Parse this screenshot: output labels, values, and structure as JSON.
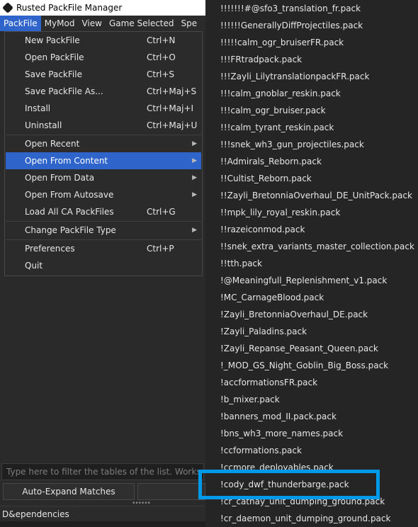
{
  "window": {
    "title": "Rusted PackFile Manager"
  },
  "menubar": [
    "PackFile",
    "MyMod",
    "View",
    "Game Selected",
    "Spe"
  ],
  "packfile_menu": {
    "items": [
      {
        "label": "New PackFile",
        "shortcut": "Ctrl+N"
      },
      {
        "label": "Open PackFile",
        "shortcut": "Ctrl+O"
      },
      {
        "label": "Save PackFile",
        "shortcut": "Ctrl+S"
      },
      {
        "label": "Save PackFile As...",
        "shortcut": "Ctrl+Maj+S"
      },
      {
        "label": "Install",
        "shortcut": "Ctrl+Maj+I"
      },
      {
        "label": "Uninstall",
        "shortcut": "Ctrl+Maj+U"
      },
      {
        "label": "Open Recent",
        "shortcut": ""
      },
      {
        "label": "Open From Content",
        "shortcut": ""
      },
      {
        "label": "Open From Data",
        "shortcut": ""
      },
      {
        "label": "Open From Autosave",
        "shortcut": ""
      },
      {
        "label": "Load All CA PackFiles",
        "shortcut": "Ctrl+G"
      },
      {
        "label": "Change PackFile Type",
        "shortcut": ""
      },
      {
        "label": "Preferences",
        "shortcut": "Ctrl+P"
      },
      {
        "label": "Quit",
        "shortcut": ""
      }
    ]
  },
  "submenu_arrow": "chevron-right-icon",
  "content_list": {
    "items": [
      "!!!!!!!#@sfo3_translation_fr.pack",
      "!!!!!!GenerallyDiffProjectiles.pack",
      "!!!!!calm_ogr_bruiserFR.pack",
      "!!!FRtradpack.pack",
      "!!!Zayli_LilytranslationpackFR.pack",
      "!!!calm_gnoblar_reskin.pack",
      "!!!calm_ogr_bruiser.pack",
      "!!!calm_tyrant_reskin.pack",
      "!!!snek_wh3_gun_projectiles.pack",
      "!!Admirals_Reborn.pack",
      "!!Cultist_Reborn.pack",
      "!!Zayli_BretonniaOverhaul_DE_UnitPack.pack",
      "!!mpk_lily_royal_reskin.pack",
      "!!razeiconmod.pack",
      "!!snek_extra_variants_master_collection.pack",
      "!!tth.pack",
      "!@Meaningfull_Replenishment_v1.pack",
      "!MC_CarnageBlood.pack",
      "!Zayli_BretonniaOverhaul_DE.pack",
      "!Zayli_Paladins.pack",
      "!Zayli_Repanse_Peasant_Queen.pack",
      "!_MOD_GS_Night_Goblin_Big_Boss.pack",
      "!accformationsFR.pack",
      "!b_mixer.pack",
      "!banners_mod_II.pack.pack",
      "!bns_wh3_more_names.pack",
      "!ccformations.pack",
      "!ccmore_deployables.pack",
      "!cody_dwf_thunderbarge.pack",
      "!cr_cathay_unit_dumping_ground.pack",
      "!cr_daemon_unit_dumping_ground.pack"
    ],
    "highlighted_index": 28,
    "highlight_color": "#009ae8"
  },
  "filter": {
    "placeholder": "Type here to filter the tables of the list. Works with Regex too!"
  },
  "buttons": {
    "auto_expand": "Auto-Expand Matches"
  },
  "dependencies": {
    "label": "D&ependencies"
  },
  "colors": {
    "accent": "#2f65ca"
  }
}
